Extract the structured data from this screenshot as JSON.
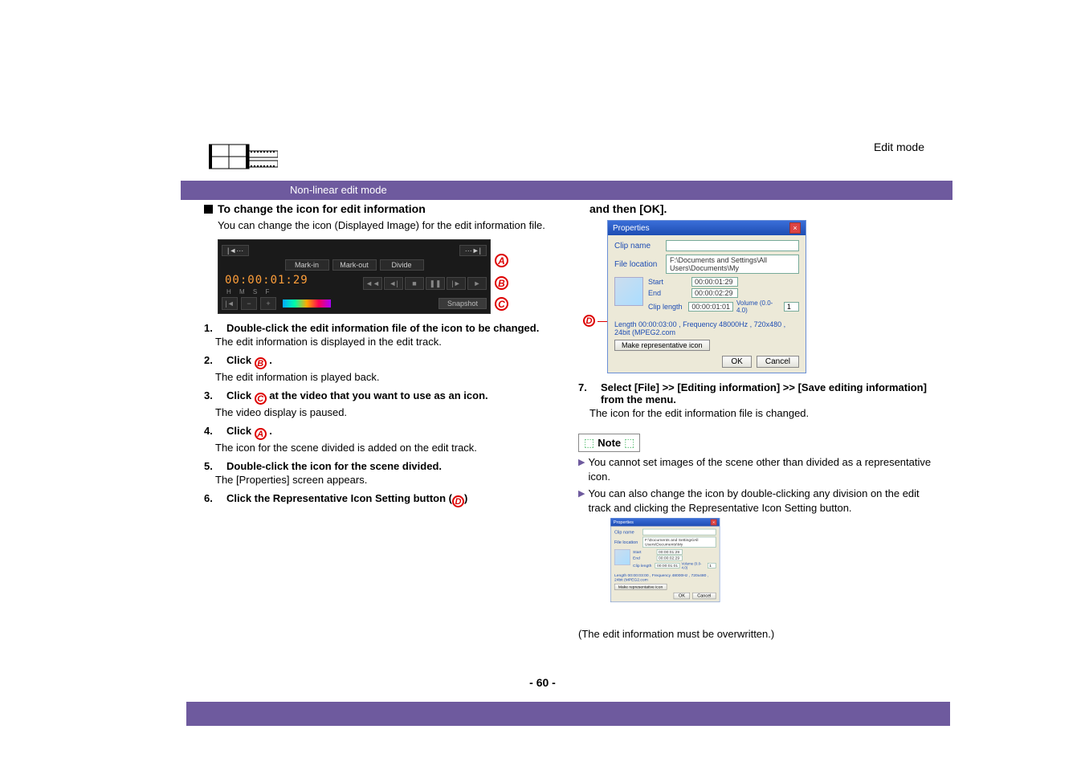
{
  "header": {
    "breadcrumb": "Edit mode"
  },
  "tabs": {
    "active": "Non-linear edit mode"
  },
  "left": {
    "title": "To change the icon for edit information",
    "intro": "You can change the icon (Displayed Image) for the edit information file.",
    "editor": {
      "mark_in": "Mark-in",
      "mark_out": "Mark-out",
      "divide": "Divide",
      "timecode": "00:00:01:29",
      "tc_labels": "H   M   S   F",
      "snapshot": "Snapshot"
    },
    "callouts": {
      "A": "A",
      "B": "B",
      "C": "C"
    },
    "steps": {
      "s1": {
        "num": "1.",
        "title": "Double-click the edit information file of the icon to be changed.",
        "desc": "The edit information is displayed in the edit track."
      },
      "s2": {
        "num": "2.",
        "title_a": "Click ",
        "title_b": " .",
        "badge": "B",
        "desc": "The edit information is played back."
      },
      "s3": {
        "num": "3.",
        "title_a": "Click ",
        "title_b": " at the video that you want to use as an icon.",
        "badge": "C",
        "desc": "The video display is paused."
      },
      "s4": {
        "num": "4.",
        "title_a": "Click ",
        "title_b": " .",
        "badge": "A",
        "desc": "The icon for the scene divided is added on the edit track."
      },
      "s5": {
        "num": "5.",
        "title": "Double-click the icon for the scene divided.",
        "desc": "The [Properties] screen appears."
      },
      "s6": {
        "num": "6.",
        "title_a": "Click the Representative Icon Setting button (",
        "title_b": ")",
        "badge": "D"
      }
    }
  },
  "right": {
    "cont": "and then [OK].",
    "dialog": {
      "title": "Properties",
      "clip_name_label": "Clip name",
      "file_location_label": "File location",
      "file_location_value": "F:\\Documents and Settings\\All Users\\Documents\\My",
      "start_label": "Start",
      "start_value": "00:00:01:29",
      "end_label": "End",
      "end_value": "00:00:02:29",
      "clip_length_label": "Clip length",
      "clip_length_value": "00:00:01:01",
      "volume_label": "Volume (0.0-4.0)",
      "volume_value": "1",
      "meta": "Length 00:00:03:00 , Frequency 48000Hz , 720x480 , 24bit (MPEG2.com",
      "rep_button": "Make representative icon",
      "ok": "OK",
      "cancel": "Cancel"
    },
    "d_badge": "D",
    "step7": {
      "num": "7.",
      "title": "Select [File] >> [Editing information] >> [Save editing information] from the menu.",
      "desc": "The icon for the edit information file is changed."
    },
    "note_label": "Note",
    "notes": {
      "n1": "You cannot set images of the scene other than divided as a representative icon.",
      "n2": "You can also change the icon by double-clicking any division on the edit track and clicking the Representative Icon Setting button."
    },
    "followup": "(The edit information must be overwritten.)"
  },
  "page_number": "- 60 -"
}
